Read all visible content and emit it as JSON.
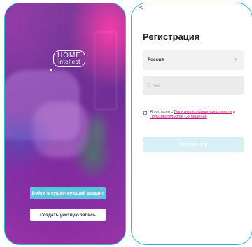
{
  "welcome": {
    "logo": {
      "line1": "HOME",
      "line2": "intellect"
    },
    "login_button": "Войти в существующий аккаунт",
    "create_button": "Создать учетную запись"
  },
  "register": {
    "back_icon": "chevron-left-icon",
    "back_glyph": "<",
    "title": "Регистрация",
    "country": {
      "value": "Россия",
      "chevron": "▼"
    },
    "email": {
      "placeholder": "E-mail",
      "value": ""
    },
    "consent": {
      "prefix": "Я согласен с ",
      "privacy_link": "Политика конфиденциальности",
      "middle": " и ",
      "terms_link": "Пользовательское Соглашение"
    },
    "get_code_button": "Получить код"
  },
  "colors": {
    "accent_border": "#2bbcd0",
    "login_button": "#5fc3dc",
    "link": "#c6207f",
    "disabled_button": "#d8f0f5"
  }
}
